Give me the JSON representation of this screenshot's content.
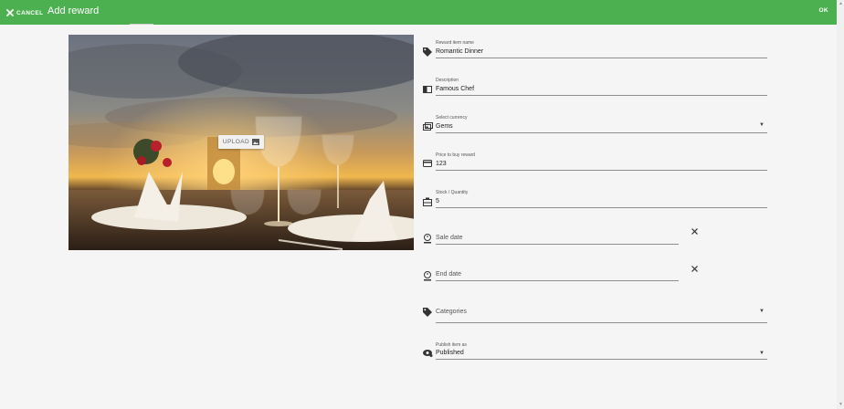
{
  "appbar": {
    "cancel_label": "CANCEL",
    "title": "Add reward",
    "ok_label": "OK",
    "color": "#4caf50"
  },
  "image": {
    "upload_label": "UPLOAD"
  },
  "form": {
    "name": {
      "label": "Reward item name",
      "value": "Romantic Dinner",
      "icon": "tag-icon"
    },
    "description": {
      "label": "Description",
      "value": "Famous Chef",
      "icon": "description-icon"
    },
    "currency": {
      "label": "Select currency",
      "value": "Gems",
      "icon": "currency-icon"
    },
    "price": {
      "label": "Price to buy reward",
      "value": "123",
      "icon": "credit-card-icon"
    },
    "stock": {
      "label": "Stock / Quantity",
      "value": "5",
      "icon": "inventory-icon"
    },
    "sale_date": {
      "placeholder": "Sale date",
      "icon": "date-icon"
    },
    "end_date": {
      "placeholder": "End date",
      "icon": "date-icon"
    },
    "categories": {
      "placeholder": "Categories",
      "icon": "tag-icon"
    },
    "publish": {
      "label": "Publish item as",
      "value": "Published",
      "icon": "visibility-icon"
    }
  }
}
